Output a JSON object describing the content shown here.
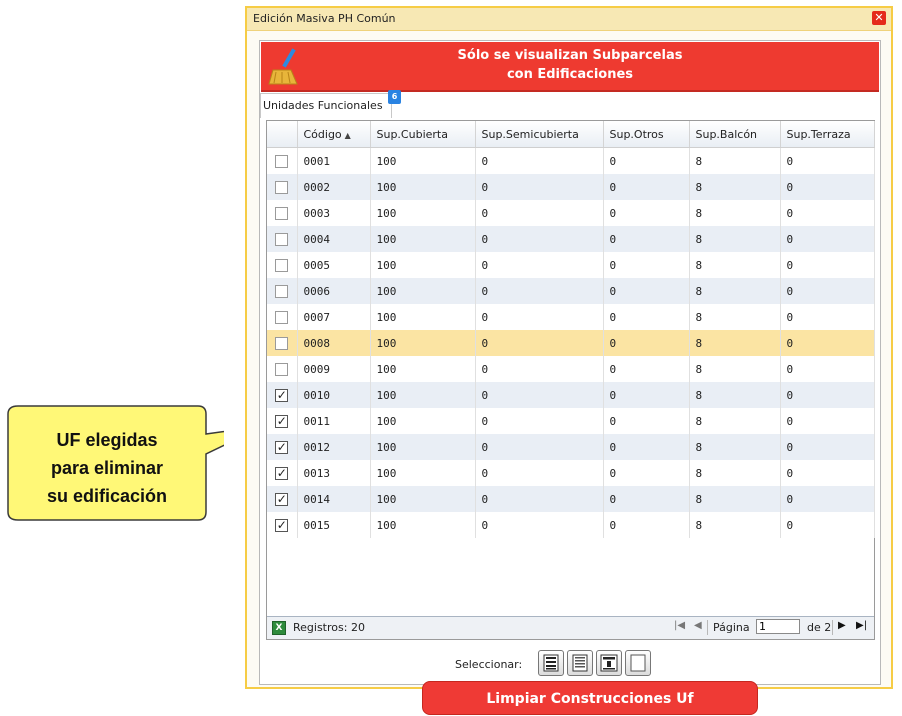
{
  "dialog": {
    "title": "Edición Masiva PH Común",
    "close_icon": "close-x-icon",
    "banner_line1": "Sólo se visualizan Subparcelas",
    "banner_line2": "con Edificaciones",
    "banner_icon": "broom-icon",
    "banner_color": "#ee3a30",
    "tab_label": "Unidades Funcionales",
    "tab_badge": "6"
  },
  "grid": {
    "columns": [
      "Código",
      "Sup.Cubierta",
      "Sup.Semicubierta",
      "Sup.Otros",
      "Sup.Balcón",
      "Sup.Terraza"
    ],
    "sort_icon": "sort-ascending-icon",
    "rows": [
      {
        "code": "0001",
        "cub": "100",
        "semi": "0",
        "otros": "0",
        "balcon": "8",
        "terraza": "0",
        "checked": false
      },
      {
        "code": "0002",
        "cub": "100",
        "semi": "0",
        "otros": "0",
        "balcon": "8",
        "terraza": "0",
        "checked": false
      },
      {
        "code": "0003",
        "cub": "100",
        "semi": "0",
        "otros": "0",
        "balcon": "8",
        "terraza": "0",
        "checked": false
      },
      {
        "code": "0004",
        "cub": "100",
        "semi": "0",
        "otros": "0",
        "balcon": "8",
        "terraza": "0",
        "checked": false
      },
      {
        "code": "0005",
        "cub": "100",
        "semi": "0",
        "otros": "0",
        "balcon": "8",
        "terraza": "0",
        "checked": false
      },
      {
        "code": "0006",
        "cub": "100",
        "semi": "0",
        "otros": "0",
        "balcon": "8",
        "terraza": "0",
        "checked": false
      },
      {
        "code": "0007",
        "cub": "100",
        "semi": "0",
        "otros": "0",
        "balcon": "8",
        "terraza": "0",
        "checked": false
      },
      {
        "code": "0008",
        "cub": "100",
        "semi": "0",
        "otros": "0",
        "balcon": "8",
        "terraza": "0",
        "checked": false,
        "highlighted": true
      },
      {
        "code": "0009",
        "cub": "100",
        "semi": "0",
        "otros": "0",
        "balcon": "8",
        "terraza": "0",
        "checked": false
      },
      {
        "code": "0010",
        "cub": "100",
        "semi": "0",
        "otros": "0",
        "balcon": "8",
        "terraza": "0",
        "checked": true
      },
      {
        "code": "0011",
        "cub": "100",
        "semi": "0",
        "otros": "0",
        "balcon": "8",
        "terraza": "0",
        "checked": true
      },
      {
        "code": "0012",
        "cub": "100",
        "semi": "0",
        "otros": "0",
        "balcon": "8",
        "terraza": "0",
        "checked": true
      },
      {
        "code": "0013",
        "cub": "100",
        "semi": "0",
        "otros": "0",
        "balcon": "8",
        "terraza": "0",
        "checked": true
      },
      {
        "code": "0014",
        "cub": "100",
        "semi": "0",
        "otros": "0",
        "balcon": "8",
        "terraza": "0",
        "checked": true
      },
      {
        "code": "0015",
        "cub": "100",
        "semi": "0",
        "otros": "0",
        "balcon": "8",
        "terraza": "0",
        "checked": true
      }
    ],
    "highlight_color": "#fbe4a3"
  },
  "pager": {
    "export_icon": "excel-export-icon",
    "records": "Registros: 20",
    "first_icon": "first-page-icon",
    "prev_icon": "prev-page-icon",
    "page_label": "Página",
    "page_value": "1",
    "of_label": "de 2",
    "next_icon": "next-page-icon",
    "last_icon": "last-page-icon"
  },
  "selection": {
    "label": "Seleccionar:",
    "buttons": [
      "select-all-icon",
      "select-page-icon",
      "select-filtered-icon",
      "select-none-icon"
    ]
  },
  "action": {
    "label": "Limpiar Construcciones Uf",
    "color": "#ef3a35"
  },
  "callout": {
    "line1": "UF elegidas",
    "line2": "para eliminar",
    "line3": "su edificación",
    "fill": "#fff877"
  }
}
